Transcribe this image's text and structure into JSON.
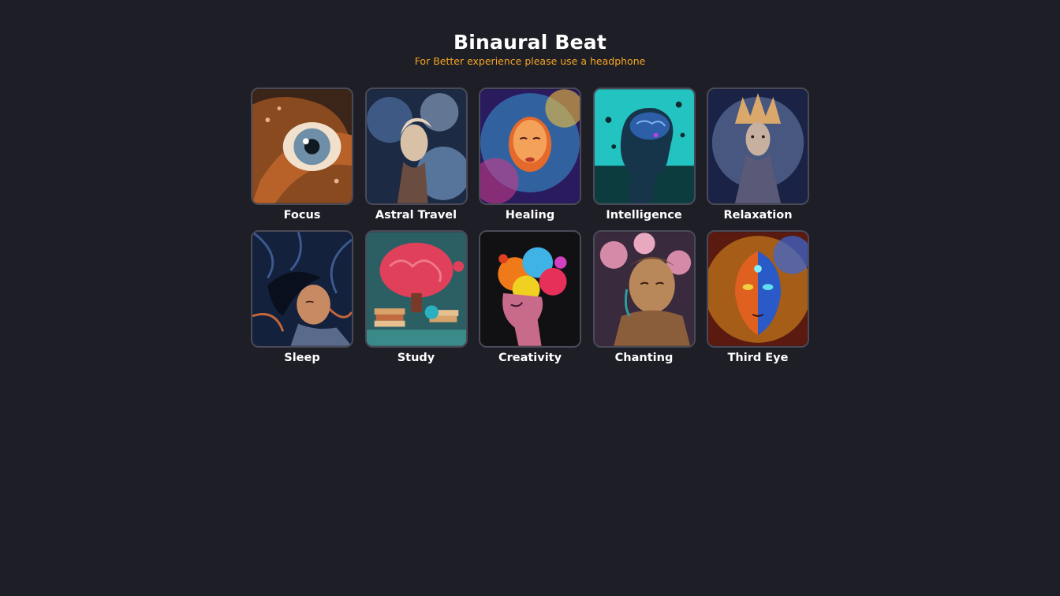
{
  "header": {
    "title": "Binaural Beat",
    "subtitle": "For Better experience please use a headphone"
  },
  "tiles": [
    {
      "label": "Focus",
      "icon": "eye-artwork",
      "colors": [
        "#3b2418",
        "#b8622a",
        "#6f8fa8"
      ]
    },
    {
      "label": "Astral Travel",
      "icon": "astral-face-artwork",
      "colors": [
        "#1c2a44",
        "#7fa6d6",
        "#d9c1a8"
      ]
    },
    {
      "label": "Healing",
      "icon": "glowing-face-artwork",
      "colors": [
        "#2a1a5e",
        "#e46a2c",
        "#3aa7e0"
      ]
    },
    {
      "label": "Intelligence",
      "icon": "brain-head-artwork",
      "colors": [
        "#0d3c3f",
        "#22c3c0",
        "#2c5fa8"
      ]
    },
    {
      "label": "Relaxation",
      "icon": "crowned-woman-artwork",
      "colors": [
        "#1a2346",
        "#8ba4d8",
        "#d9a86a"
      ]
    },
    {
      "label": "Sleep",
      "icon": "sleeping-woman-artwork",
      "colors": [
        "#14213d",
        "#3c5a8f",
        "#c4663a"
      ]
    },
    {
      "label": "Study",
      "icon": "brain-books-artwork",
      "colors": [
        "#2c5f64",
        "#e0405a",
        "#d8a36a"
      ]
    },
    {
      "label": "Creativity",
      "icon": "color-splash-head-artwork",
      "colors": [
        "#111114",
        "#f07a1a",
        "#3fb3e6"
      ]
    },
    {
      "label": "Chanting",
      "icon": "buddha-artwork",
      "colors": [
        "#3a2a3e",
        "#b8875a",
        "#d58aa8"
      ]
    },
    {
      "label": "Third Eye",
      "icon": "third-eye-face-artwork",
      "colors": [
        "#5a1a10",
        "#f0a020",
        "#3a6ad8"
      ]
    }
  ]
}
